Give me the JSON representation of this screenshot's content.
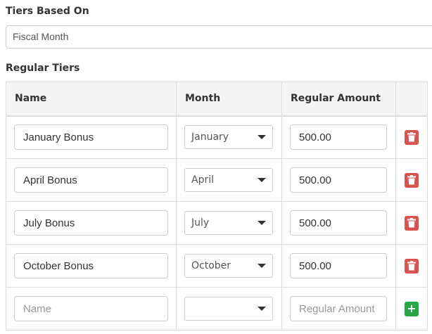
{
  "tiers_based_on": {
    "label": "Tiers Based On",
    "value": "Fiscal Month"
  },
  "regular_tiers": {
    "label": "Regular Tiers",
    "columns": [
      "Name",
      "Month",
      "Regular Amount",
      ""
    ],
    "rows": [
      {
        "name": "January Bonus",
        "month": "January",
        "amount": "500.00"
      },
      {
        "name": "April Bonus",
        "month": "April",
        "amount": "500.00"
      },
      {
        "name": "July Bonus",
        "month": "July",
        "amount": "500.00"
      },
      {
        "name": "October Bonus",
        "month": "October",
        "amount": "500.00"
      }
    ],
    "new_row": {
      "name_placeholder": "Name",
      "month": "",
      "amount_placeholder": "Regular Amount"
    }
  },
  "icons": {
    "delete": "trash-icon",
    "add": "plus-icon",
    "dropdown": "caret-down-icon"
  },
  "colors": {
    "delete_button": "#d9534f",
    "add_button": "#28a745",
    "header_bg": "#f5f5f5"
  }
}
